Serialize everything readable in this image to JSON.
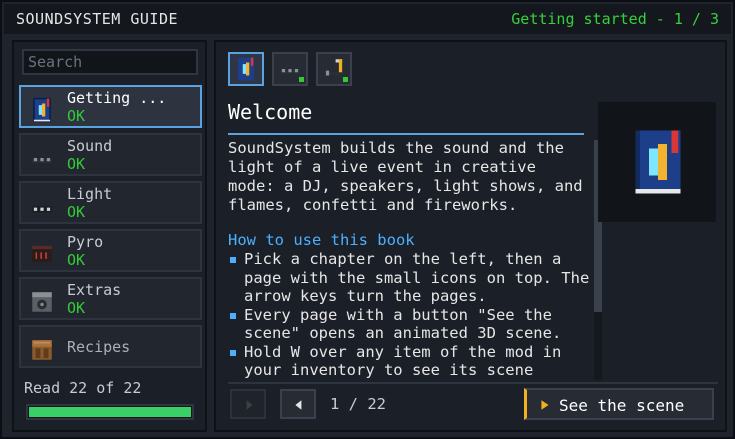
{
  "window": {
    "title": "SOUNDSYSTEM GUIDE",
    "progress": "Getting started - 1 / 3"
  },
  "sidebar": {
    "search_placeholder": "Search",
    "chapters": [
      {
        "name": "Getting ...",
        "status": "OK",
        "icon": "book-icon",
        "selected": true
      },
      {
        "name": "Sound",
        "status": "OK",
        "icon": "cable-icon"
      },
      {
        "name": "Light",
        "status": "OK",
        "icon": "light-fixture-icon"
      },
      {
        "name": "Pyro",
        "status": "OK",
        "icon": "pyro-box-icon"
      },
      {
        "name": "Extras",
        "status": "OK",
        "icon": "speaker-block-icon"
      },
      {
        "name": "Recipes",
        "status": "",
        "icon": "crafting-table-icon"
      }
    ],
    "read_text": "Read 22 of 22",
    "read_fraction": 1.0
  },
  "page_tabs": [
    {
      "icon": "book-icon",
      "selected": true,
      "done": false
    },
    {
      "icon": "cable-icon",
      "selected": false,
      "done": true
    },
    {
      "icon": "hook-cable-icon",
      "selected": false,
      "done": true
    }
  ],
  "content": {
    "heading": "Welcome",
    "intro": "SoundSystem builds the sound and the light of a live event in creative mode: a DJ, speakers, light shows, and flames, confetti and fireworks.",
    "subheading": "How to use this book",
    "bullets": [
      "Pick a chapter on the left, then a page with the small icons on top. The arrow keys turn the pages.",
      "Every page with a button \"See the scene\" opens an animated 3D scene.",
      "Hold W over any item of the mod in your inventory to see its scene"
    ],
    "preview_icon": "book-icon"
  },
  "footer": {
    "page_number": "1 / 22",
    "scene_button": "See the scene"
  },
  "colors": {
    "accent_blue": "#5aa2e0",
    "ok_green": "#35c938",
    "bar_green": "#39d067",
    "scene_accent": "#f0b020"
  }
}
